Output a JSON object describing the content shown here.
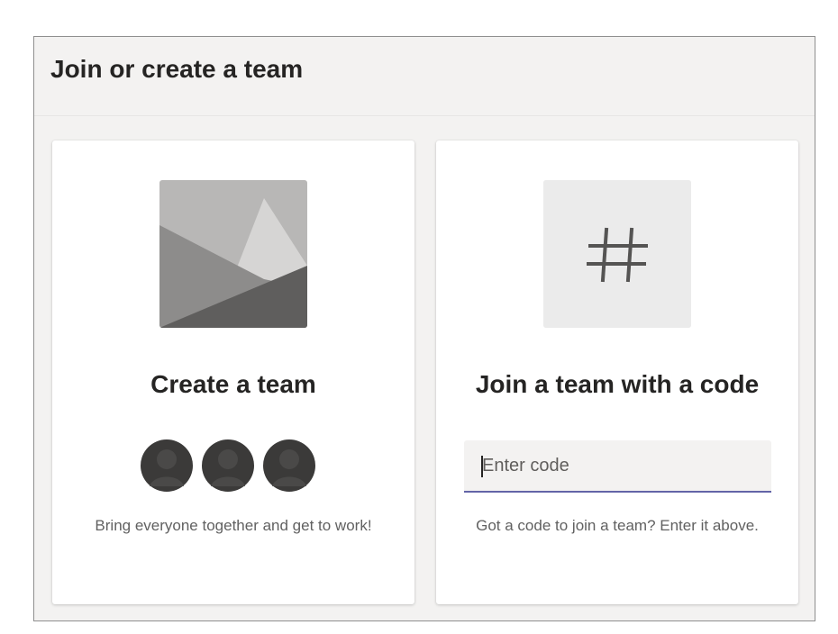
{
  "dialog": {
    "title": "Join or create a team"
  },
  "create_card": {
    "title": "Create a team",
    "description": "Bring everyone together and get to work!",
    "art_icon": "mountain-image-icon",
    "avatar_icon": "person-avatar-icon"
  },
  "join_card": {
    "title": "Join a team with a code",
    "input_value": "",
    "input_placeholder": "Enter code",
    "description": "Got a code to join a team? Enter it above.",
    "art_icon": "hashtag-icon"
  },
  "colors": {
    "accent": "#6264a7",
    "panel_bg": "#f3f2f1",
    "card_bg": "#ffffff",
    "text_primary": "#252423",
    "text_secondary": "#616161"
  }
}
